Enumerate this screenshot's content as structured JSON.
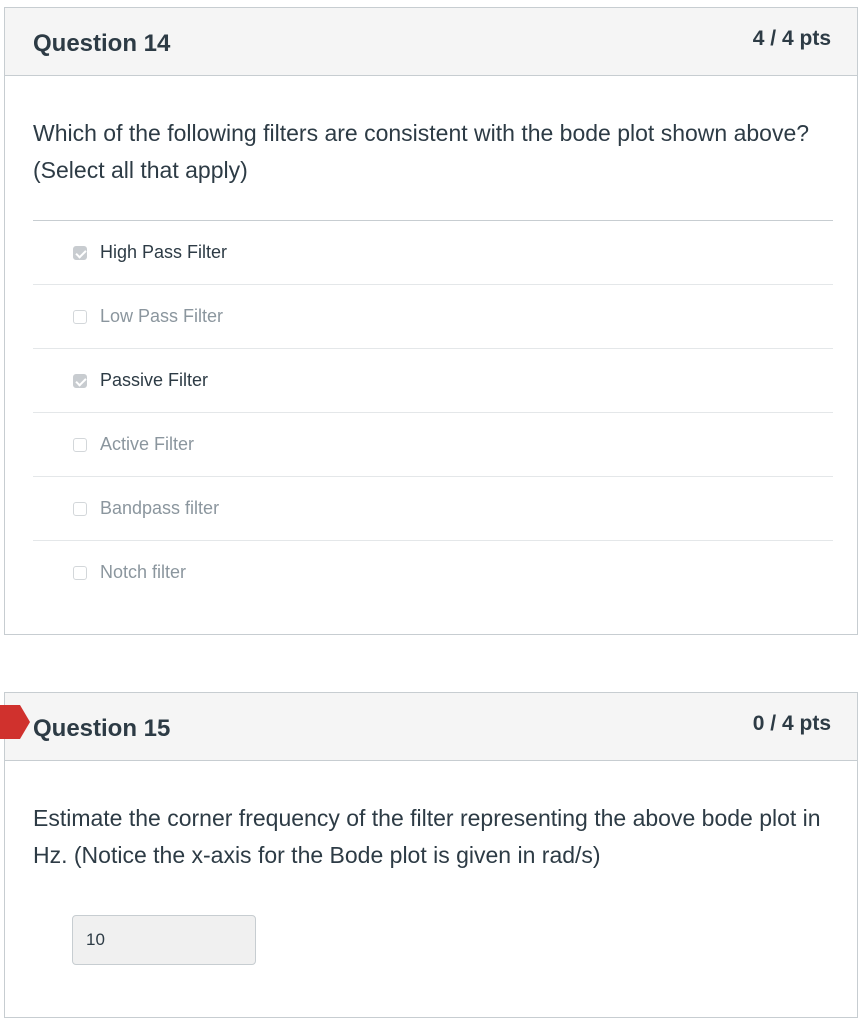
{
  "questions": [
    {
      "title": "Question 14",
      "points": "4 / 4 pts",
      "text": "Which of the following filters are consistent with the bode plot shown above? (Select all that apply)",
      "answers": [
        {
          "label": "High Pass Filter",
          "checked": true
        },
        {
          "label": "Low Pass Filter",
          "checked": false
        },
        {
          "label": "Passive Filter",
          "checked": true
        },
        {
          "label": "Active Filter",
          "checked": false
        },
        {
          "label": "Bandpass filter",
          "checked": false
        },
        {
          "label": "Notch filter",
          "checked": false
        }
      ]
    },
    {
      "title": "Question 15",
      "points": "0 / 4 pts",
      "text": "Estimate the corner frequency of the filter representing the above bode plot in Hz. (Notice the x-axis for the Bode plot is given in rad/s)",
      "answer_value": "10",
      "status_icon": "incorrect-flag-icon",
      "status_color": "#d0312d"
    }
  ],
  "colors": {
    "header_bg": "#f5f5f5",
    "border": "#c7cdd1",
    "text": "#2d3b45",
    "muted_text": "#8b969e",
    "incorrect": "#d0312d"
  }
}
